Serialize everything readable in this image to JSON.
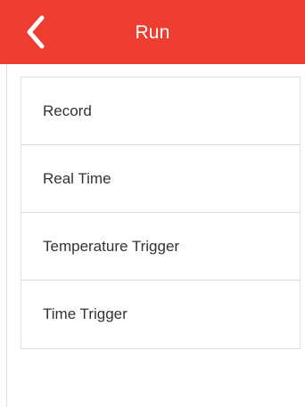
{
  "header": {
    "title": "Run",
    "back_icon": "chevron-left-icon",
    "accent_color": "#ee3d31"
  },
  "menu": {
    "items": [
      {
        "label": "Record"
      },
      {
        "label": "Real Time"
      },
      {
        "label": "Temperature Trigger"
      },
      {
        "label": "Time Trigger"
      }
    ]
  }
}
